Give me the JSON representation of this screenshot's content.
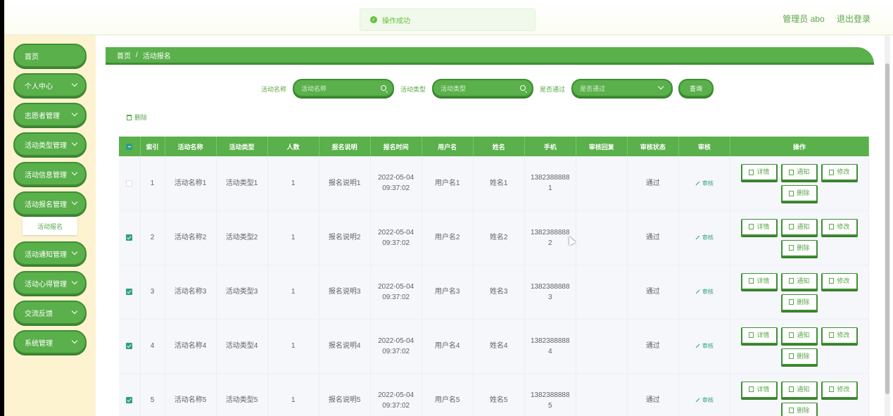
{
  "toast": {
    "message": "操作成功",
    "icon": "check-circle-icon"
  },
  "header": {
    "user_label": "管理员 abo",
    "logout_label": "退出登录"
  },
  "sidebar": {
    "items": [
      {
        "label": "首页",
        "has_children": false
      },
      {
        "label": "个人中心",
        "has_children": true
      },
      {
        "label": "志愿者管理",
        "has_children": true
      },
      {
        "label": "活动类型管理",
        "has_children": true
      },
      {
        "label": "活动信息管理",
        "has_children": true
      },
      {
        "label": "活动报名管理",
        "has_children": true
      },
      {
        "label": "活动通知管理",
        "has_children": true
      },
      {
        "label": "活动心得管理",
        "has_children": true
      },
      {
        "label": "交流反馈",
        "has_children": true
      },
      {
        "label": "系统管理",
        "has_children": true
      }
    ],
    "active_submenu": "活动报名"
  },
  "breadcrumb": {
    "home": "首页",
    "separator": "/",
    "current": "活动报名"
  },
  "search": {
    "name_label": "活动名称",
    "name_placeholder": "活动名称",
    "type_label": "活动类型",
    "type_placeholder": "活动类型",
    "pass_label": "是否通过",
    "pass_placeholder": "是否通过",
    "query_label": "查询"
  },
  "toolbar": {
    "delete_label": "删除"
  },
  "table": {
    "headers": [
      "索引",
      "活动名称",
      "活动类型",
      "人数",
      "报名说明",
      "报名时间",
      "用户名",
      "姓名",
      "手机",
      "审核回复",
      "审核状态",
      "审核",
      "操作"
    ],
    "rows": [
      {
        "checked": false,
        "index": "1",
        "name": "活动名称1",
        "type": "活动类型1",
        "count": "1",
        "desc": "报名说明1",
        "date": "2022-05-04",
        "time": "09:37:02",
        "username": "用户名1",
        "realname": "姓名1",
        "phone_a": "1382388888",
        "phone_b": "1",
        "reply": "",
        "status": "通过"
      },
      {
        "checked": true,
        "index": "2",
        "name": "活动名称2",
        "type": "活动类型2",
        "count": "1",
        "desc": "报名说明2",
        "date": "2022-05-04",
        "time": "09:37:02",
        "username": "用户名2",
        "realname": "姓名2",
        "phone_a": "1382388888",
        "phone_b": "2",
        "reply": "",
        "status": "通过"
      },
      {
        "checked": true,
        "index": "3",
        "name": "活动名称3",
        "type": "活动类型3",
        "count": "1",
        "desc": "报名说明3",
        "date": "2022-05-04",
        "time": "09:37:02",
        "username": "用户名3",
        "realname": "姓名3",
        "phone_a": "1382388888",
        "phone_b": "3",
        "reply": "",
        "status": "通过"
      },
      {
        "checked": true,
        "index": "4",
        "name": "活动名称4",
        "type": "活动类型4",
        "count": "1",
        "desc": "报名说明4",
        "date": "2022-05-04",
        "time": "09:37:02",
        "username": "用户名4",
        "realname": "姓名4",
        "phone_a": "1382388888",
        "phone_b": "4",
        "reply": "",
        "status": "通过"
      },
      {
        "checked": true,
        "index": "5",
        "name": "活动名称5",
        "type": "活动类型5",
        "count": "1",
        "desc": "报名说明5",
        "date": "2022-05-04",
        "time": "09:37:02",
        "username": "用户名5",
        "realname": "姓名5",
        "phone_a": "1382388888",
        "phone_b": "5",
        "reply": "",
        "status": "通过"
      }
    ],
    "audit_label": "审核",
    "actions": {
      "detail": "详情",
      "notify": "通知",
      "edit": "修改",
      "delete": "删除"
    }
  },
  "colors": {
    "primary": "#5ab04b",
    "primary_dark": "#3e8f33",
    "sidebar_bg": "#fdf3d0",
    "checkbox": "#2f9e84",
    "toast_bg": "#f0f9eb"
  }
}
